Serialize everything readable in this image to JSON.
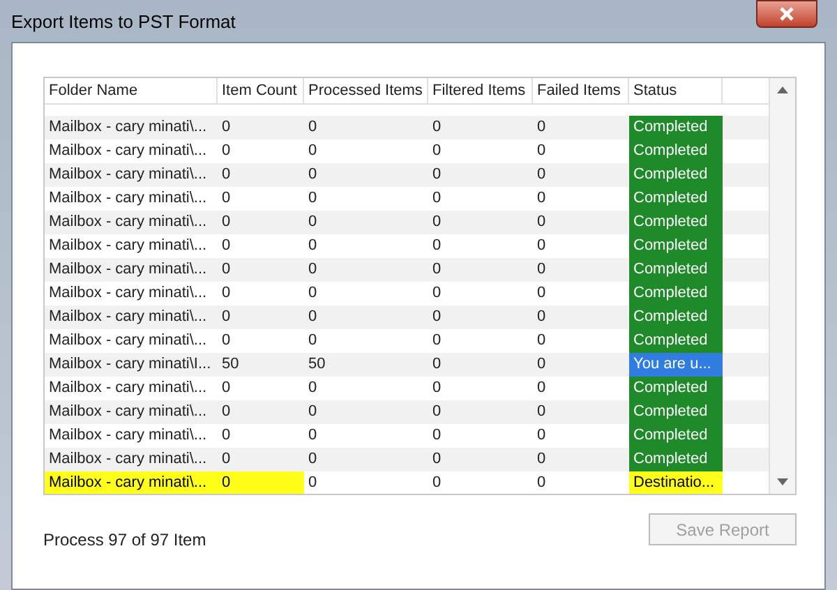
{
  "window": {
    "title": "Export Items to PST Format"
  },
  "table": {
    "columns": [
      "Folder Name",
      "Item Count",
      "Processed Items",
      "Filtered Items",
      "Failed Items",
      "Status"
    ],
    "rows": [
      {
        "cells": [
          "Mailbox - cary minati\\...",
          "0",
          "0",
          "0",
          "0",
          "Completed"
        ],
        "kind": "success",
        "highlighted": false
      },
      {
        "cells": [
          "Mailbox - cary minati\\...",
          "0",
          "0",
          "0",
          "0",
          "Completed"
        ],
        "kind": "success",
        "highlighted": false
      },
      {
        "cells": [
          "Mailbox - cary minati\\...",
          "0",
          "0",
          "0",
          "0",
          "Completed"
        ],
        "kind": "success",
        "highlighted": false
      },
      {
        "cells": [
          "Mailbox - cary minati\\...",
          "0",
          "0",
          "0",
          "0",
          "Completed"
        ],
        "kind": "success",
        "highlighted": false
      },
      {
        "cells": [
          "Mailbox - cary minati\\...",
          "0",
          "0",
          "0",
          "0",
          "Completed"
        ],
        "kind": "success",
        "highlighted": false
      },
      {
        "cells": [
          "Mailbox - cary minati\\...",
          "0",
          "0",
          "0",
          "0",
          "Completed"
        ],
        "kind": "success",
        "highlighted": false
      },
      {
        "cells": [
          "Mailbox - cary minati\\...",
          "0",
          "0",
          "0",
          "0",
          "Completed"
        ],
        "kind": "success",
        "highlighted": false
      },
      {
        "cells": [
          "Mailbox - cary minati\\...",
          "0",
          "0",
          "0",
          "0",
          "Completed"
        ],
        "kind": "success",
        "highlighted": false
      },
      {
        "cells": [
          "Mailbox - cary minati\\...",
          "0",
          "0",
          "0",
          "0",
          "Completed"
        ],
        "kind": "success",
        "highlighted": false
      },
      {
        "cells": [
          "Mailbox - cary minati\\...",
          "0",
          "0",
          "0",
          "0",
          "Completed"
        ],
        "kind": "success",
        "highlighted": false
      },
      {
        "cells": [
          "Mailbox - cary minati\\I...",
          "50",
          "50",
          "0",
          "0",
          "You are u..."
        ],
        "kind": "info",
        "highlighted": false
      },
      {
        "cells": [
          "Mailbox - cary minati\\...",
          "0",
          "0",
          "0",
          "0",
          "Completed"
        ],
        "kind": "success",
        "highlighted": false
      },
      {
        "cells": [
          "Mailbox - cary minati\\...",
          "0",
          "0",
          "0",
          "0",
          "Completed"
        ],
        "kind": "success",
        "highlighted": false
      },
      {
        "cells": [
          "Mailbox - cary minati\\...",
          "0",
          "0",
          "0",
          "0",
          "Completed"
        ],
        "kind": "success",
        "highlighted": false
      },
      {
        "cells": [
          "Mailbox - cary minati\\...",
          "0",
          "0",
          "0",
          "0",
          "Completed"
        ],
        "kind": "success",
        "highlighted": false
      },
      {
        "cells": [
          "Mailbox - cary minati\\...",
          "0",
          "0",
          "0",
          "0",
          "Destinatio..."
        ],
        "kind": "warning",
        "highlighted": true
      }
    ]
  },
  "progress_text": "Process 97 of 97 Item",
  "save_button": {
    "label": "Save Report",
    "disabled": true
  }
}
